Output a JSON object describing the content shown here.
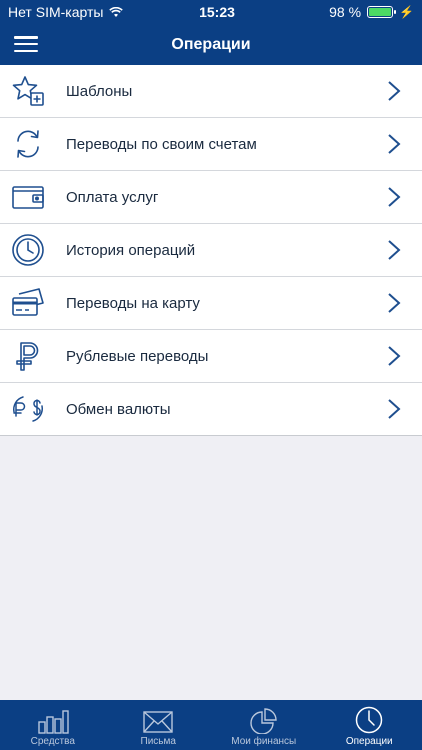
{
  "status_bar": {
    "carrier": "Нет SIM-карты",
    "time": "15:23",
    "battery_percent": "98 %",
    "battery_level": 0.98
  },
  "header": {
    "title": "Операции"
  },
  "operations": [
    {
      "label": "Шаблоны",
      "icon": "star-plus-icon"
    },
    {
      "label": "Переводы по своим счетам",
      "icon": "transfer-arrows-icon"
    },
    {
      "label": "Оплата услуг",
      "icon": "wallet-icon"
    },
    {
      "label": "История операций",
      "icon": "clock-icon"
    },
    {
      "label": "Переводы на карту",
      "icon": "cards-icon"
    },
    {
      "label": "Рублевые переводы",
      "icon": "ruble-icon"
    },
    {
      "label": "Обмен валюты",
      "icon": "currency-exchange-icon"
    }
  ],
  "tabs": [
    {
      "label": "Средства",
      "icon": "bar-chart-icon",
      "active": false
    },
    {
      "label": "Письма",
      "icon": "envelope-icon",
      "active": false
    },
    {
      "label": "Мои финансы",
      "icon": "pie-chart-icon",
      "active": false
    },
    {
      "label": "Операции",
      "icon": "clock-icon",
      "active": true
    }
  ],
  "colors": {
    "brand": "#0b3f84",
    "icon": "#1f4f8f",
    "background": "#efeff4"
  }
}
